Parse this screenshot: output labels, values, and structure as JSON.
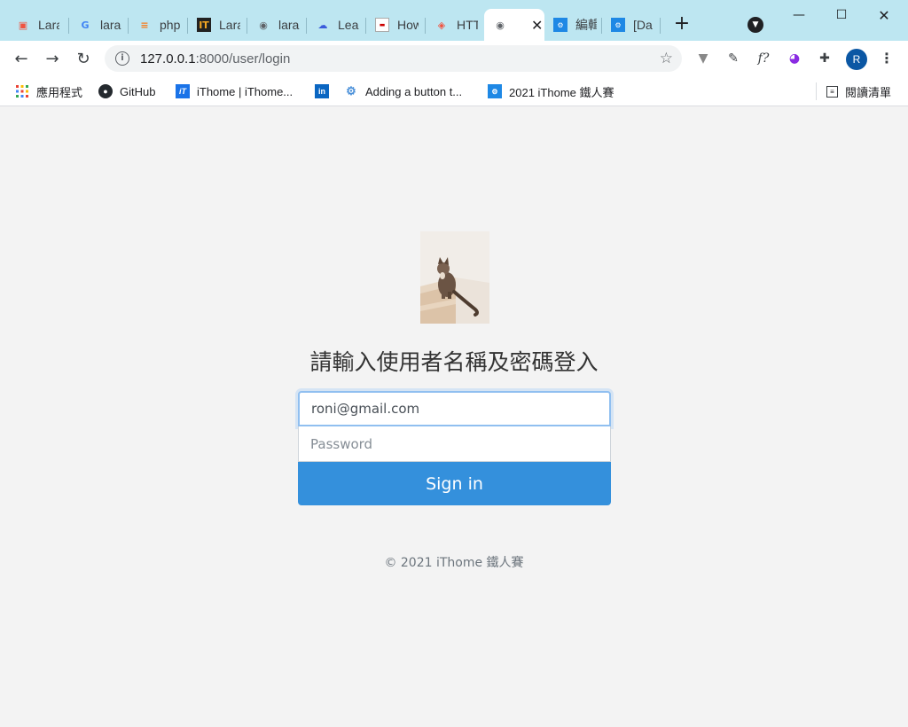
{
  "tabs": [
    {
      "title": "Lara",
      "icon": "laravel-icon"
    },
    {
      "title": "lara",
      "icon": "google-icon"
    },
    {
      "title": "php",
      "icon": "stackoverflow-icon"
    },
    {
      "title": "Lara",
      "icon": "ithome-icon"
    },
    {
      "title": "lara",
      "icon": "globe-icon"
    },
    {
      "title": "Lear",
      "icon": "cloud-icon"
    },
    {
      "title": "How",
      "icon": "site-icon"
    },
    {
      "title": "HTT",
      "icon": "laravel-icon"
    },
    {
      "title": "",
      "icon": "globe-icon",
      "active": true
    },
    {
      "title": "編輯",
      "icon": "ironman-icon"
    },
    {
      "title": "[Da",
      "icon": "ironman-icon"
    }
  ],
  "address": {
    "host": "127.0.0.1",
    "rest": ":8000/user/login"
  },
  "profile_initial": "R",
  "bookmarks": {
    "apps": "應用程式",
    "github": "GitHub",
    "ithome": "iThome | iThome...",
    "adding": "Adding a button t...",
    "ironman": "2021 iThome 鐵人賽",
    "reading_list": "閱讀清單"
  },
  "login": {
    "heading": "請輸入使用者名稱及密碼登入",
    "email_value": "roni@gmail.com",
    "password_placeholder": "Password",
    "signin_label": "Sign in",
    "footer": "© 2021 iThome 鐵人賽"
  },
  "colors": {
    "primary": "#3490dc",
    "tabstrip": "#bde6f1"
  }
}
